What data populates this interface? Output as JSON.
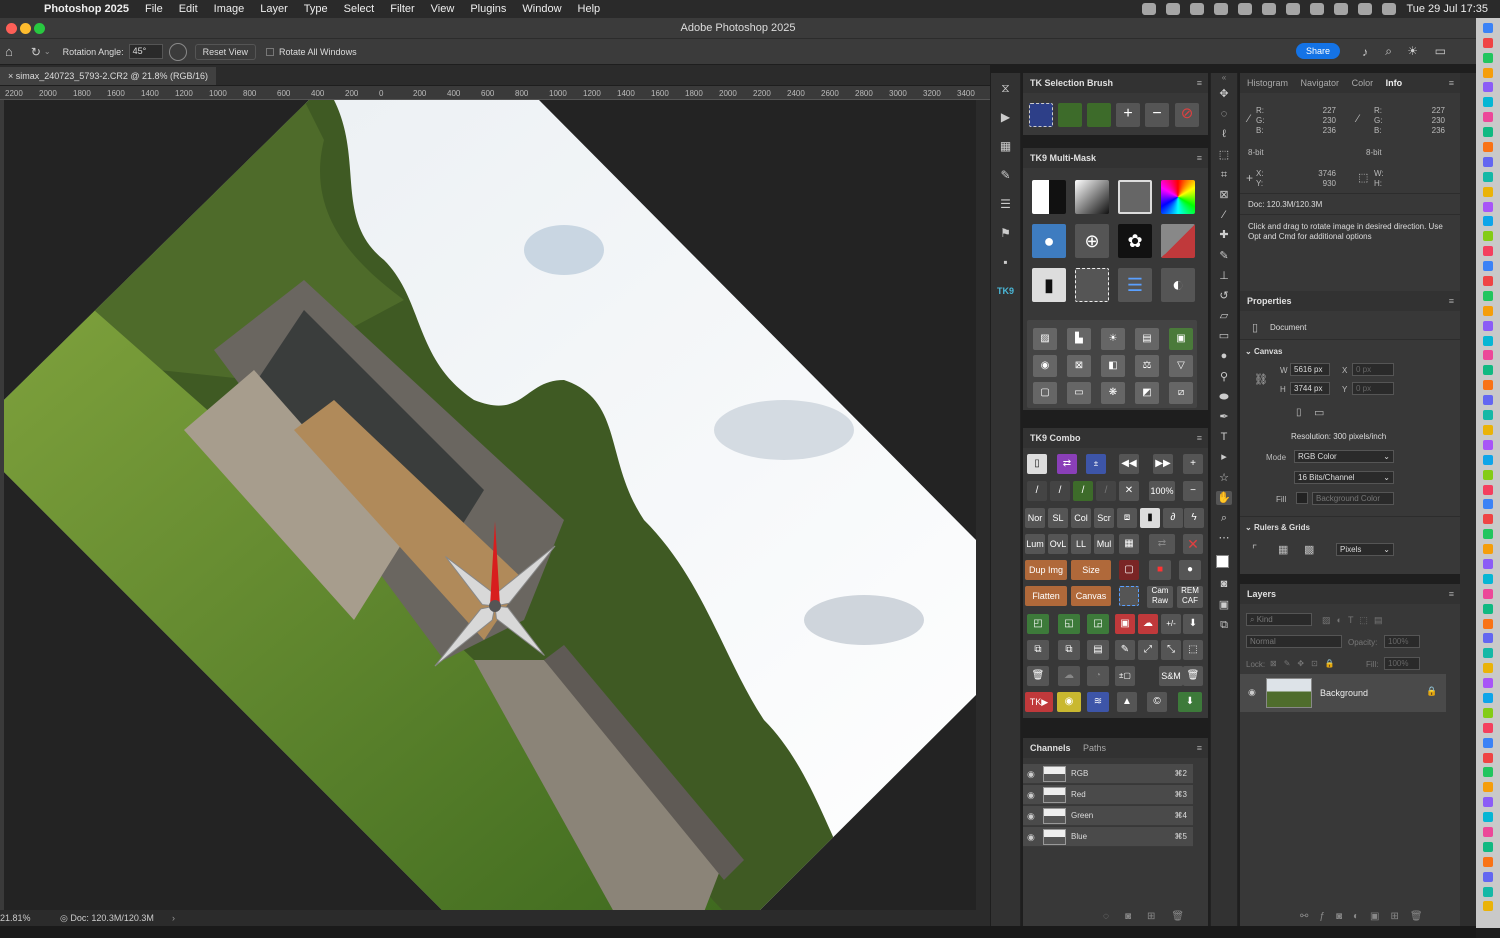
{
  "menubar": {
    "app": "Photoshop 2025",
    "items": [
      "File",
      "Edit",
      "Image",
      "Layer",
      "Type",
      "Select",
      "Filter",
      "View",
      "Plugins",
      "Window",
      "Help"
    ],
    "datetime": "Tue 29 Jul  17:35"
  },
  "window": {
    "title": "Adobe Photoshop 2025"
  },
  "options": {
    "rotation_label": "Rotation Angle:",
    "rotation_value": "45°",
    "reset_view": "Reset View",
    "rotate_all": "Rotate All Windows",
    "share": "Share"
  },
  "document": {
    "tab": "simax_240723_5793-2.CR2 @ 21.8% (RGB/16)",
    "zoom": "21.81%",
    "doc_size": "Doc: 120.3M/120.3M"
  },
  "ruler_labels": [
    "2200",
    "2000",
    "1800",
    "1600",
    "1400",
    "1200",
    "1000",
    "800",
    "600",
    "400",
    "200",
    "0",
    "200",
    "400",
    "600",
    "800",
    "1000",
    "1200",
    "1400",
    "1600",
    "1800",
    "2000",
    "2200",
    "2400",
    "2600",
    "2800",
    "3000",
    "3200",
    "3400"
  ],
  "tk_selection": {
    "title": "TK Selection Brush"
  },
  "tk_multimask": {
    "title": "TK9 Multi-Mask"
  },
  "tk_combo": {
    "title": "TK9 Combo",
    "labels": {
      "pct": "100%",
      "nor": "Nor",
      "sl": "SL",
      "col": "Col",
      "scr": "Scr",
      "lum": "Lum",
      "ovl": "OvL",
      "ll": "LL",
      "mul": "Mul",
      "dup": "Dup Img",
      "size": "Size",
      "flatten": "Flatten",
      "canvas": "Canvas",
      "camraw": "Cam Raw",
      "remcaf": "REM CAF",
      "sm": "S&M",
      "tk": "TK"
    }
  },
  "channels": {
    "tabs": [
      "Channels",
      "Paths"
    ],
    "rows": [
      {
        "name": "RGB",
        "key": "⌘2"
      },
      {
        "name": "Red",
        "key": "⌘3"
      },
      {
        "name": "Green",
        "key": "⌘4"
      },
      {
        "name": "Blue",
        "key": "⌘5"
      }
    ]
  },
  "info": {
    "tabs": [
      "Histogram",
      "Navigator",
      "Color",
      "Info"
    ],
    "r": "227",
    "g": "230",
    "b": "236",
    "r2": "227",
    "g2": "230",
    "b2": "236",
    "bit": "8-bit",
    "bit2": "8-bit",
    "x": "3746",
    "y": "930",
    "doc": "Doc: 120.3M/120.3M",
    "hint": "Click and drag to rotate image in desired direction. Use Opt and Cmd for additional options"
  },
  "properties": {
    "title": "Properties",
    "document": "Document",
    "canvas": "Canvas",
    "w": "5616 px",
    "h": "3744 px",
    "x_ph": "0 px",
    "y_ph": "0 px",
    "resolution": "Resolution: 300 pixels/inch",
    "mode_label": "Mode",
    "mode": "RGB Color",
    "depth": "16 Bits/Channel",
    "fill_label": "Fill",
    "fill": "Background Color",
    "rulers": "Rulers & Grids",
    "units": "Pixels"
  },
  "layers": {
    "title": "Layers",
    "kind": "Kind",
    "blend": "Normal",
    "opacity_label": "Opacity:",
    "opacity": "100%",
    "lock_label": "Lock:",
    "fill_label": "Fill:",
    "fill": "100%",
    "layer_name": "Background"
  },
  "colors": {
    "accent": "#1473e6",
    "panel": "#383838",
    "canvas_bg": "#232323"
  }
}
